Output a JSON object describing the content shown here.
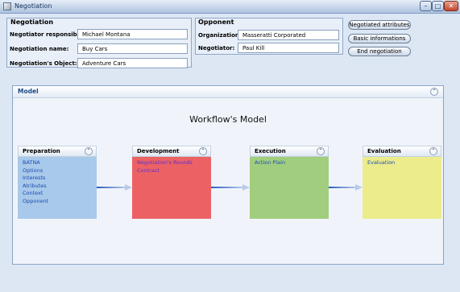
{
  "window": {
    "title": "Negotiation"
  },
  "negotiation": {
    "section_title": "Negotiation",
    "responsible_label": "Negotiator responsible:",
    "responsible_value": "Michael Montana",
    "name_label": "Negotiation name:",
    "name_value": "Buy Cars",
    "object_label": "Negotiation's Object:",
    "object_value": "Adventure Cars"
  },
  "opponent": {
    "section_title": "Opponent",
    "organization_label": "Organization:",
    "organization_value": "Masseratti Corporated",
    "negotiator_label": "Negotiator:",
    "negotiator_value": "Paul Kill"
  },
  "actions": {
    "negotiated_attributes": "Negotiated attributes",
    "basic_informations": "Basic informations",
    "end_negotiation": "End negotiation"
  },
  "model": {
    "title": "Model",
    "workflow_title": "Workflow's Model",
    "stages": [
      {
        "title": "Preparation",
        "items": [
          "BATNA",
          "Options",
          "Interests",
          "Atributes",
          "Context",
          "Opponent"
        ],
        "color": "#a8c9ea"
      },
      {
        "title": "Development",
        "items": [
          "Negotiation's Rounds",
          "Contract"
        ],
        "color": "#ec6264"
      },
      {
        "title": "Execution",
        "items": [
          "Action Plain"
        ],
        "color": "#a1cd7e"
      },
      {
        "title": "Evaluation",
        "items": [
          "Evaluation"
        ],
        "color": "#ecec8c"
      }
    ]
  },
  "icons": {
    "window_app": "app-icon",
    "minimize": "minimize-icon",
    "maximize": "maximize-icon",
    "close": "close-icon",
    "collapse": "chevron-up-icon"
  },
  "colors": {
    "accent": "#1c4a87",
    "arrow": "#7f9fd4"
  }
}
